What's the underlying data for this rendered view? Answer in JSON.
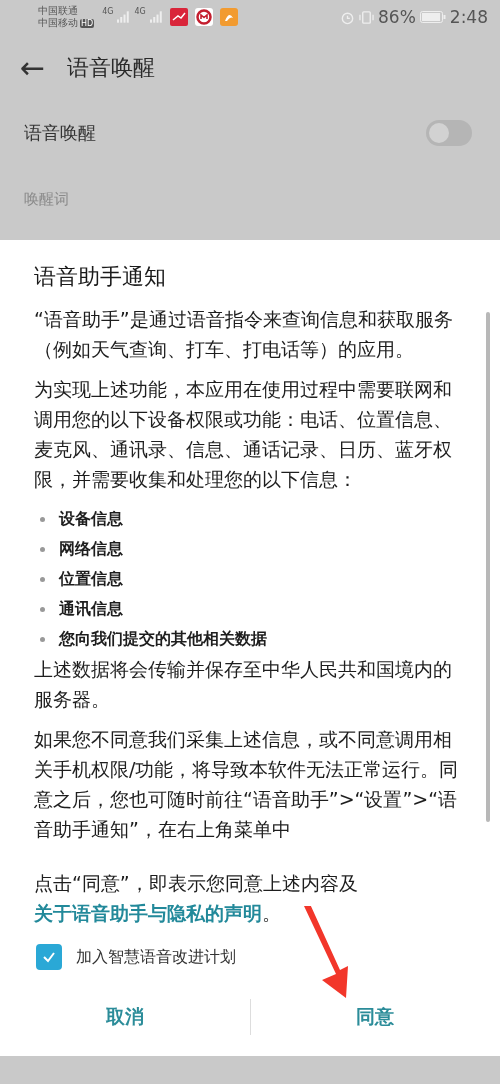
{
  "status_bar": {
    "carriers": [
      "中国联通",
      "中国移动"
    ],
    "hd_badge": "HD",
    "network": [
      "4G",
      "4G"
    ],
    "battery_text": "86%",
    "time": "2:48"
  },
  "header": {
    "back": "←",
    "title": "语音唤醒"
  },
  "settings": [
    {
      "label": "语音唤醒",
      "kind": "toggle",
      "on": false
    },
    {
      "label": "唤醒词",
      "kind": "section"
    }
  ],
  "dialog": {
    "title": "语音助手通知",
    "paragraphs": [
      "“语音助手”是通过语音指令来查询信息和获取服务（例如天气查询、打车、打电话等）的应用。",
      "为实现上述功能，本应用在使用过程中需要联网和调用您的以下设备权限或功能：电话、位置信息、麦克风、通讯录、信息、通话记录、日历、蓝牙权限，并需要收集和处理您的以下信息："
    ],
    "bullets": [
      "设备信息",
      "网络信息",
      "位置信息",
      "通讯信息",
      "您向我们提交的其他相关数据"
    ],
    "paragraphs_after": [
      "上述数据将会传输并保存至中华人民共和国境内的服务器。",
      "如果您不同意我们采集上述信息，或不同意调用相关手机权限/功能，将导致本软件无法正常运行。同意之后，您也可随时前往“语音助手”>“设置”>“语音助手通知”，在右上角菜单中"
    ],
    "consent": {
      "text": "点击“同意”，即表示您同意上述内容及",
      "link": "关于语音助手与隐私的声明",
      "end": "。"
    },
    "checkbox": {
      "label": "加入智慧语音改进计划",
      "checked": true
    },
    "buttons": [
      {
        "label": "取消"
      },
      {
        "label": "同意"
      }
    ]
  }
}
